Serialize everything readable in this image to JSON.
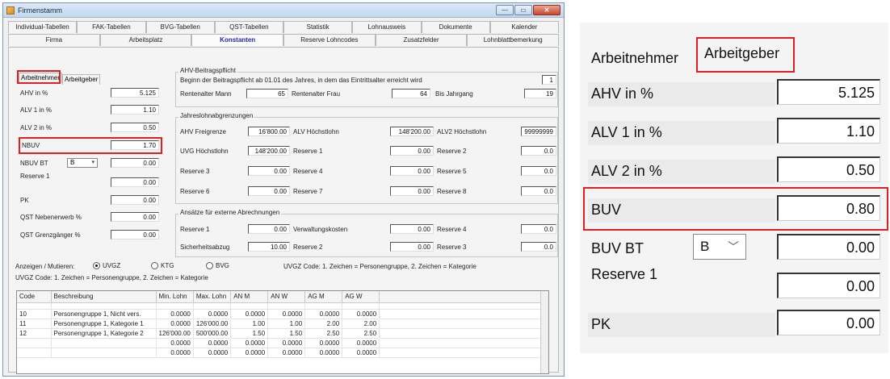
{
  "window": {
    "title": "Firmenstamm",
    "buttons": {
      "minimize": "—",
      "maximize": "▭",
      "close": "✕"
    }
  },
  "tabs_row1": [
    "Individual-Tabellen",
    "FAK-Tabellen",
    "BVG-Tabellen",
    "QST-Tabellen",
    "Statistik",
    "Lohnausweis",
    "Dokumente",
    "Kalender"
  ],
  "tabs_row2": [
    "Firma",
    "Arbeitsplatz",
    "Konstanten",
    "Reserve Lohncodes",
    "Zusatzfelder",
    "Lohnblattbemerkung"
  ],
  "active_tab": "Konstanten",
  "left_panel": {
    "subtabs": [
      "Arbeitnehmer",
      "Arbeitgeber"
    ],
    "rows": [
      {
        "label": "AHV in %",
        "value": "5.125"
      },
      {
        "label": "ALV 1 in %",
        "value": "1.10"
      },
      {
        "label": "ALV 2 in %",
        "value": "0.50"
      },
      {
        "label": "NBUV",
        "value": "1.70"
      },
      {
        "label": "NBUV BT",
        "select": "B",
        "value": "0.00"
      },
      {
        "label": "Reserve 1",
        "value": "0.00"
      },
      {
        "label": "PK",
        "value": "0.00"
      },
      {
        "label": "QST Nebenerwerb %",
        "value": "0.00"
      },
      {
        "label": "QST Grenzgänger %",
        "value": "0.00"
      }
    ]
  },
  "ahv_group": {
    "title": "AHV-Beitragspflicht",
    "text": "Beginn der Beitragspflicht ab 01.01 des Jahres, in dem das Eintrittsalter erreicht wird",
    "value": "1",
    "rentenalter_mann_label": "Rentenalter Mann",
    "rentenalter_mann": "65",
    "rentenalter_frau_label": "Rentenalter Frau",
    "rentenalter_frau": "64",
    "bis_jahrgang_label": "Bis Jahrgang",
    "bis_jahrgang": "19"
  },
  "jahres_group": {
    "title": "Jahreslohnabgrenzungen",
    "rows": [
      [
        {
          "label": "AHV Freigrenze",
          "value": "16'800.00"
        },
        {
          "label": "ALV Höchstlohn",
          "value": "148'200.00"
        },
        {
          "label": "ALV2 Höchstlohn",
          "value": "99999999"
        }
      ],
      [
        {
          "label": "UVG Höchstlohn",
          "value": "148'200.00"
        },
        {
          "label": "Reserve 1",
          "value": "0.00"
        },
        {
          "label": "Reserve 2",
          "value": "0.0"
        }
      ],
      [
        {
          "label": "Reserve 3",
          "value": "0.00"
        },
        {
          "label": "Reserve 4",
          "value": "0.00"
        },
        {
          "label": "Reserve 5",
          "value": "0.0"
        }
      ],
      [
        {
          "label": "Reserve 6",
          "value": "0.00"
        },
        {
          "label": "Reserve 7",
          "value": "0.00"
        },
        {
          "label": "Reserve 8",
          "value": "0.0"
        }
      ]
    ]
  },
  "ansaetze_group": {
    "title": "Ansätze für externe Abrechnungen",
    "rows": [
      [
        {
          "label": "Reserve 1",
          "value": "0.00"
        },
        {
          "label": "Verwaltungskosten",
          "value": "0.00"
        },
        {
          "label": "Reserve 4",
          "value": "0.0"
        }
      ],
      [
        {
          "label": "Sicherheitsabzug",
          "value": "10.00"
        },
        {
          "label": "Reserve 2",
          "value": "0.00"
        },
        {
          "label": "Reserve 3",
          "value": "0.0"
        }
      ]
    ]
  },
  "anzeigen": {
    "label": "Anzeigen / Mutieren:",
    "options": [
      "UVGZ",
      "KTG",
      "BVG"
    ],
    "selected": "UVGZ",
    "code_hint": "UVGZ Code: 1. Zeichen = Personengruppe, 2. Zeichen = Kategorie",
    "table_title": "UVGZ Code: 1. Zeichen = Personengruppe, 2. Zeichen = Kategorie"
  },
  "table": {
    "columns": [
      "Code",
      "Beschreibung",
      "Min. Lohn",
      "Max. Lohn",
      "AN M",
      "AN W",
      "AG M",
      "AG W"
    ],
    "rows": [
      [
        "10",
        "Personengruppe 1, Nicht vers.",
        "0.0000",
        "0.0000",
        "0.0000",
        "0.0000",
        "0.0000",
        "0.0000"
      ],
      [
        "11",
        "Personengruppe 1, Kategorie 1",
        "0.0000",
        "126'000.00",
        "1.00",
        "1.00",
        "2.00",
        "2.00"
      ],
      [
        "12",
        "Personengruppe 1, Kategorie 2",
        "126'000.00",
        "500'000.00",
        "1.50",
        "1.50",
        "2.50",
        "2.50"
      ],
      [
        "",
        "",
        "0.0000",
        "0.0000",
        "0.0000",
        "0.0000",
        "0.0000",
        "0.0000"
      ],
      [
        "",
        "",
        "0.0000",
        "0.0000",
        "0.0000",
        "0.0000",
        "0.0000",
        "0.0000"
      ]
    ]
  },
  "zoom_panel": {
    "tabs": [
      "Arbeitnehmer",
      "Arbeitgeber"
    ],
    "rows": [
      {
        "label": "AHV in %",
        "value": "5.125"
      },
      {
        "label": "ALV 1 in %",
        "value": "1.10"
      },
      {
        "label": "ALV 2 in %",
        "value": "0.50"
      },
      {
        "label": "BUV",
        "value": "0.80"
      },
      {
        "label": "BUV BT",
        "select": "B",
        "value": "0.00"
      },
      {
        "label": "Reserve 1",
        "value": "0.00"
      },
      {
        "label": "PK",
        "value": "0.00"
      }
    ]
  },
  "colors": {
    "highlight": "#e02020",
    "active_tab_text": "#2a2a9a"
  }
}
